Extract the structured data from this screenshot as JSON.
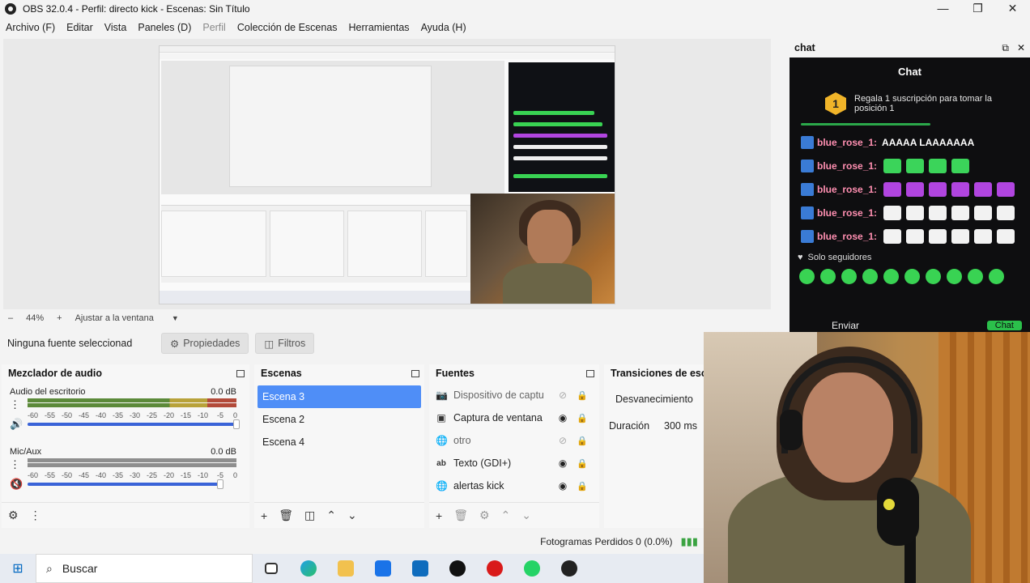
{
  "window": {
    "title": "OBS 32.0.4 - Perfil: directo kick - Escenas: Sin Título",
    "controls": [
      "—",
      "❐",
      "✕"
    ]
  },
  "menu": [
    "Archivo (F)",
    "Editar",
    "Vista",
    "Paneles (D)",
    "Perfil",
    "Colección de Escenas",
    "Herramientas",
    "Ayuda (H)"
  ],
  "preview": {
    "zoom_minus": "–",
    "zoom": "44%",
    "zoom_plus": "+",
    "fit": "Ajustar a la ventana"
  },
  "source_toolbar": {
    "no_source": "Ninguna fuente seleccionad",
    "properties": "Propiedades",
    "filters": "Filtros"
  },
  "mixer": {
    "title": "Mezclador de audio",
    "ticks": [
      "-60",
      "-55",
      "-50",
      "-45",
      "-40",
      "-35",
      "-30",
      "-25",
      "-20",
      "-15",
      "-10",
      "-5",
      "0"
    ],
    "channels": [
      {
        "name": "Audio del escritorio",
        "db": "0.0 dB",
        "muted": false,
        "volume": 1.0
      },
      {
        "name": "Mic/Aux",
        "db": "0.0 dB",
        "muted": true,
        "volume": 1.0
      }
    ]
  },
  "scenes": {
    "title": "Escenas",
    "items": [
      "Escena 3",
      "Escena 2",
      "Escena 4"
    ],
    "selected": "Escena 3"
  },
  "sources": {
    "title": "Fuentes",
    "items": [
      {
        "name": "Dispositivo de captu",
        "icon": "camera-icon",
        "visible": false
      },
      {
        "name": "Captura de ventana",
        "icon": "window-icon",
        "visible": true
      },
      {
        "name": "otro",
        "icon": "globe-icon",
        "visible": false
      },
      {
        "name": "Texto (GDI+)",
        "icon": "text-icon",
        "visible": true
      },
      {
        "name": "alertas kick",
        "icon": "globe-icon",
        "visible": true
      }
    ]
  },
  "transitions": {
    "title": "Transiciones de esc",
    "selected": "Desvanecimiento",
    "duration_label": "Duración",
    "duration_value": "300 ms"
  },
  "status": {
    "dropped": "Fotogramas Perdidos 0 (0.0%)"
  },
  "taskbar": {
    "search": "Buscar"
  },
  "chat": {
    "dock_title": "chat",
    "title": "Chat",
    "gift_rank": "1",
    "gift_text": "Regala 1 suscripción para tomar la posición 1",
    "messages": [
      {
        "user": "blue_rose_1:",
        "text": "AAAAA LAAAAAAA",
        "emotes": []
      },
      {
        "user": "blue_rose_1:",
        "text": "",
        "emotes": [
          "#3bd45a",
          "#3bd45a",
          "#3bd45a",
          "#3bd45a"
        ]
      },
      {
        "user": "blue_rose_1:",
        "text": "",
        "emotes": [
          "#b145e0",
          "#b145e0",
          "#b145e0",
          "#b145e0",
          "#b145e0",
          "#b145e0"
        ]
      },
      {
        "user": "blue_rose_1:",
        "text": "",
        "emotes": [
          "#f2f2f2",
          "#f2f2f2",
          "#f2f2f2",
          "#f2f2f2",
          "#f2f2f2",
          "#f2f2f2"
        ]
      },
      {
        "user": "blue_rose_1:",
        "text": "",
        "emotes": [
          "#f2f2f2",
          "#f2f2f2",
          "#f2f2f2",
          "#f2f2f2",
          "#f2f2f2",
          "#f2f2f2"
        ]
      }
    ],
    "followers_only": "Solo seguidores",
    "send": "Enviar",
    "chat_button": "Chat"
  },
  "colors": {
    "accent": "#4f8ef7",
    "chat_user": "#ff8fb1",
    "kick_green": "#2bbf4b"
  }
}
